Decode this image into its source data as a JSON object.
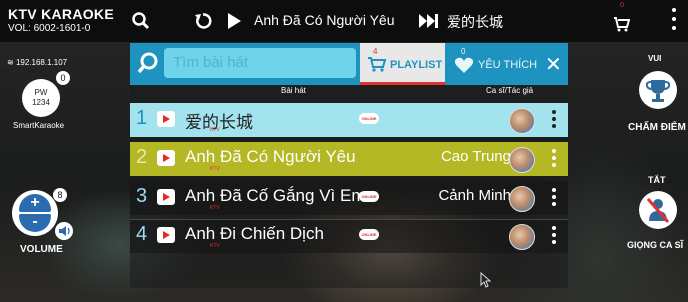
{
  "app": {
    "title": "KTV KARAOKE",
    "version": "VOL: 6002-1601-0"
  },
  "topbar": {
    "now_playing": "Anh Đã Có Người Yêu",
    "next_song": "爱的长城",
    "cart_count": "0"
  },
  "left": {
    "ip": "192.168.1.107",
    "pw_badge": "0",
    "pw_line1": "PW",
    "pw_line2": "1234",
    "smart_label": "SmartKaraoke",
    "volume_plus": "+",
    "volume_minus": "-",
    "volume_value": "8",
    "volume_label": "VOLUME"
  },
  "right": {
    "vui_label": "VUI",
    "cham_diem_label": "CHẤM ĐIỂM",
    "tat_label": "TẮT",
    "giong_label": "GIỌNG CA SĨ"
  },
  "panel": {
    "search_placeholder": "Tìm bài hát",
    "playlist_label": "PLAYLIST",
    "playlist_count": "4",
    "favorite_label": "YÊU THÍCH",
    "favorite_count": "0",
    "col_song": "Bài hát",
    "col_artist": "Ca sĩ/Tác giả",
    "online_badge": "ONLINE",
    "rows": [
      {
        "num": "1",
        "title": "爱的长城",
        "sub": "KTV",
        "artist": ""
      },
      {
        "num": "2",
        "title": "Anh Đã Có Người Yêu",
        "sub": "KTV",
        "artist": "Cao Trung"
      },
      {
        "num": "3",
        "title": "Anh Đã Cố Gắng Vì Em",
        "sub": "KTV",
        "artist": "Cảnh Minh"
      },
      {
        "num": "4",
        "title": "Anh Đi Chiến Dịch",
        "sub": "KTV",
        "artist": ""
      }
    ]
  },
  "colors": {
    "accent": "#1e93c0",
    "selected_row": "#b5b825",
    "playing_row": "#a3e3ee",
    "red": "#e03030"
  }
}
